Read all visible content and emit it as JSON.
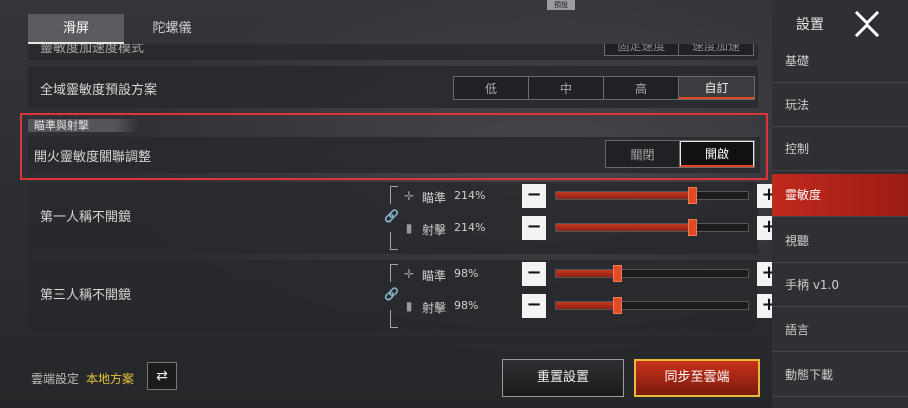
{
  "tabs": [
    {
      "label": "滑屏",
      "active": true
    },
    {
      "label": "陀螺儀",
      "active": false
    }
  ],
  "partial_row": {
    "label": "靈敏度加速度模式",
    "options": [
      "固定速度",
      "速度加速"
    ]
  },
  "preset": {
    "label": "全域靈敏度預設方案",
    "badge": "預設",
    "options": [
      "低",
      "中",
      "高",
      "自訂"
    ],
    "selected": "自訂"
  },
  "aim_section": {
    "header": "瞄準與射擊",
    "row_label": "開火靈敏度關聯調整",
    "options": [
      "關閉",
      "開啟"
    ],
    "selected": "開啟"
  },
  "groups": [
    {
      "label": "第一人稱不開鏡",
      "sliders": [
        {
          "name": "瞄準",
          "value": "214%",
          "fraction": 0.71
        },
        {
          "name": "射擊",
          "value": "214%",
          "fraction": 0.71
        }
      ]
    },
    {
      "label": "第三人稱不開鏡",
      "sliders": [
        {
          "name": "瞄準",
          "value": "98%",
          "fraction": 0.32
        },
        {
          "name": "射擊",
          "value": "98%",
          "fraction": 0.32
        }
      ]
    }
  ],
  "footer": {
    "cloud_label": "雲端設定",
    "cloud_value": "本地方案",
    "reset_label": "重置設置",
    "sync_label": "同步至雲端"
  },
  "sidebar": {
    "title": "設置",
    "items": [
      {
        "label": "基礎",
        "active": false
      },
      {
        "label": "玩法",
        "active": false
      },
      {
        "label": "控制",
        "active": false
      },
      {
        "label": "靈敏度",
        "active": true
      },
      {
        "label": "視聽",
        "active": false
      },
      {
        "label": "手柄 v1.0",
        "active": false
      },
      {
        "label": "語言",
        "active": false
      },
      {
        "label": "動態下載",
        "active": false
      }
    ]
  },
  "colors": {
    "accent": "#c9311c",
    "highlight_border": "#d9353a",
    "gold": "#e9b93c"
  }
}
